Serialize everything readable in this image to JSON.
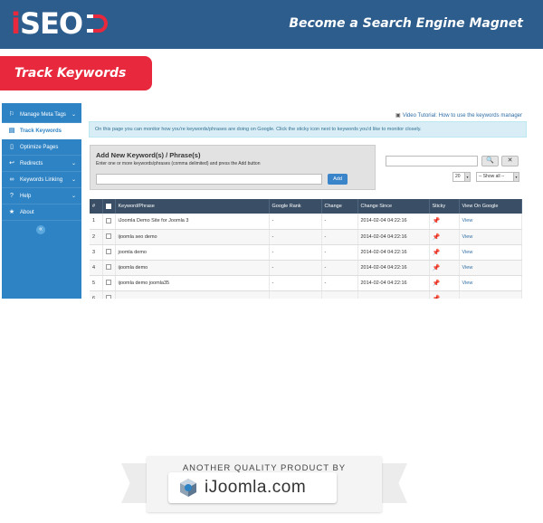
{
  "header": {
    "logo_letter": "i",
    "logo_word": "SEO",
    "tagline": "Become a Search Engine Magnet"
  },
  "banner": {
    "title": "Track Keywords"
  },
  "colors": {
    "header_bg": "#2d5d8c",
    "accent_red": "#e8283c",
    "sidebar_bg": "#2e83c4",
    "table_header_bg": "#3a4f66"
  },
  "sidebar": {
    "items": [
      {
        "label": "Manage Meta Tags",
        "icon": "tag-icon",
        "glyph": "⚐",
        "has_chevron": true
      },
      {
        "label": "Track Keywords",
        "icon": "document-icon",
        "glyph": "▤",
        "active": true
      },
      {
        "label": "Optimize Pages",
        "icon": "page-icon",
        "glyph": "▯"
      },
      {
        "label": "Redirects",
        "icon": "redirect-arrow-icon",
        "glyph": "↩",
        "has_chevron": true
      },
      {
        "label": "Keywords Linking",
        "icon": "link-icon",
        "glyph": "∞",
        "has_chevron": true
      },
      {
        "label": "Help",
        "icon": "help-icon",
        "glyph": "?",
        "has_chevron": true
      },
      {
        "label": "About",
        "icon": "star-icon",
        "glyph": "★"
      }
    ],
    "chevron_glyph": "⌄",
    "collapse_glyph": "«"
  },
  "content": {
    "video_tutorial": "Video Tutorial: How to use the keywords manager",
    "info_text": "On this page you can monitor how you're keywords/phrases are doing on Google. Click the sticky icon next to keywords you'd like to monitor closely.",
    "add_panel": {
      "title": "Add New Keyword(s) / Phrase(s)",
      "hint": "Enter one or more keywords/phrases (comma delimited) and press the Add button",
      "add_label": "Add"
    },
    "search_glyph": "🔍",
    "clear_glyph": "✕",
    "limit_value": "20",
    "show_value": "-- Show all --",
    "select_arrow": "▾"
  },
  "table": {
    "headers": [
      "#",
      "",
      "Keyword/Phrase",
      "Google Rank",
      "Change",
      "Change Since",
      "Sticky",
      "View On Google"
    ],
    "rows": [
      {
        "num": "1",
        "keyword": "iJoomla Demo Site for Joomla 3",
        "rank": "-",
        "change": "-",
        "since": "2014-02-04 04:22:16",
        "view": "View"
      },
      {
        "num": "2",
        "keyword": "ijoomla seo demo",
        "rank": "-",
        "change": "-",
        "since": "2014-02-04 04:22:16",
        "view": "View"
      },
      {
        "num": "3",
        "keyword": "joomla demo",
        "rank": "-",
        "change": "-",
        "since": "2014-02-04 04:22:16",
        "view": "View"
      },
      {
        "num": "4",
        "keyword": "ijoomla demo",
        "rank": "-",
        "change": "-",
        "since": "2014-02-04 04:22:16",
        "view": "View"
      },
      {
        "num": "5",
        "keyword": "ijoomla demo joomla35",
        "rank": "-",
        "change": "-",
        "since": "2014-02-04 04:22:16",
        "view": "View"
      },
      {
        "num": "6",
        "keyword": "",
        "rank": "",
        "change": "",
        "since": "",
        "view": ""
      }
    ],
    "pin_glyph": "📌"
  },
  "footer": {
    "caption": "ANOTHER QUALITY PRODUCT BY",
    "brand": "iJoomla.com"
  }
}
